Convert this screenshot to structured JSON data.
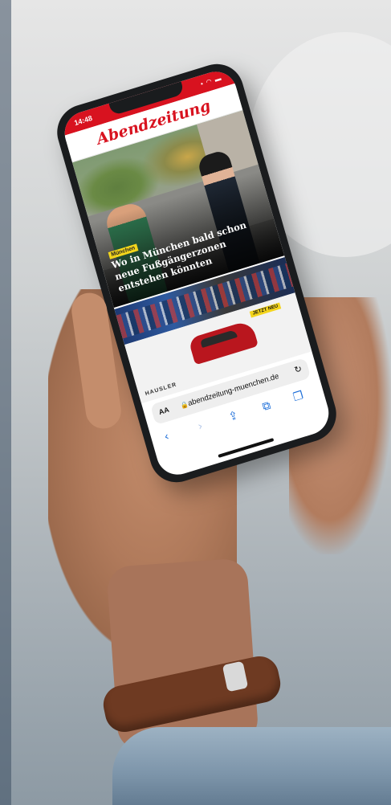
{
  "phone": {
    "time": "14:48",
    "status_icons": "▪ ◠ ▬",
    "site_logo": "Abendzeitung",
    "article": {
      "category_badge": "München",
      "headline": "Wo in München bald schon neue Fußgängerzonen entstehen könnten"
    },
    "ad": {
      "badge": "JETZT NEU",
      "brand": "HAUSLER"
    },
    "browser": {
      "aa_label": "AA",
      "lock_icon": "🔒",
      "url": "abendzeitung-muenchen.de",
      "reload_icon": "↻",
      "toolbar": {
        "back": "‹",
        "forward": "›",
        "share": "⇪",
        "bookmarks": "⧉",
        "tabs": "❐"
      }
    }
  },
  "colors": {
    "brand_red": "#d8121f",
    "badge_yellow": "#f2d51b",
    "ios_blue": "#1e6fd9"
  }
}
